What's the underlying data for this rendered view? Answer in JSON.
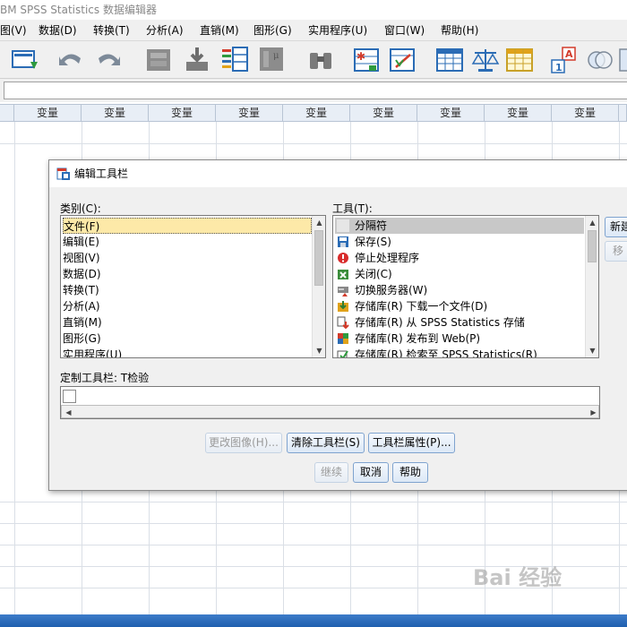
{
  "window": {
    "title": "BM SPSS Statistics 数据编辑器"
  },
  "menu": [
    "图(V)",
    "数据(D)",
    "转换(T)",
    "分析(A)",
    "直销(M)",
    "图形(G)",
    "实用程序(U)",
    "窗口(W)",
    "帮助(H)"
  ],
  "toolbar_icons": [
    "open-data-icon",
    "undo-icon",
    "redo-icon",
    "goto-case-icon",
    "goto-variable-icon",
    "variables-icon",
    "descriptive-stats-icon",
    "find-icon",
    "insert-cases-icon",
    "insert-variable-icon",
    "split-file-icon",
    "weight-cases-icon",
    "select-cases-icon",
    "value-labels-icon",
    "use-sets-icon",
    "show-all-icon"
  ],
  "grid": {
    "column_header": "变量"
  },
  "dialog": {
    "title": "编辑工具栏",
    "categories_label": "类别(C):",
    "categories": [
      "文件(F)",
      "编辑(E)",
      "视图(V)",
      "数据(D)",
      "转换(T)",
      "分析(A)",
      "直销(M)",
      "图形(G)",
      "实用程序(U)"
    ],
    "tools_label": "工具(T):",
    "tools": [
      {
        "label": "分隔符",
        "icon": "separator-icon"
      },
      {
        "label": "保存(S)",
        "icon": "save-icon"
      },
      {
        "label": "停止处理程序",
        "icon": "stop-icon"
      },
      {
        "label": "关闭(C)",
        "icon": "close-file-icon"
      },
      {
        "label": "切换服务器(W)",
        "icon": "server-icon"
      },
      {
        "label": "存储库(R) 下载一个文件(D)",
        "icon": "repository-download-icon"
      },
      {
        "label": "存储库(R) 从 SPSS Statistics 存储",
        "icon": "repository-store-icon"
      },
      {
        "label": "存储库(R) 发布到 Web(P)",
        "icon": "repository-publish-icon"
      },
      {
        "label": "存储库(R) 检索至 SPSS Statistics(R)",
        "icon": "repository-retrieve-icon"
      }
    ],
    "new_button": "新建",
    "move_button": "移",
    "custom_toolbar_label": "定制工具栏: T检验",
    "change_image_button": "更改图像(H)...",
    "clear_toolbar_button": "清除工具栏(S)",
    "toolbar_props_button": "工具栏属性(P)...",
    "continue_button": "继续",
    "cancel_button": "取消",
    "help_button": "帮助"
  },
  "watermark": "Bai 经验",
  "colors": {
    "selection": "#fde9a8",
    "header_bg": "#e8eef6",
    "taskbar": "#2a6bbc"
  }
}
